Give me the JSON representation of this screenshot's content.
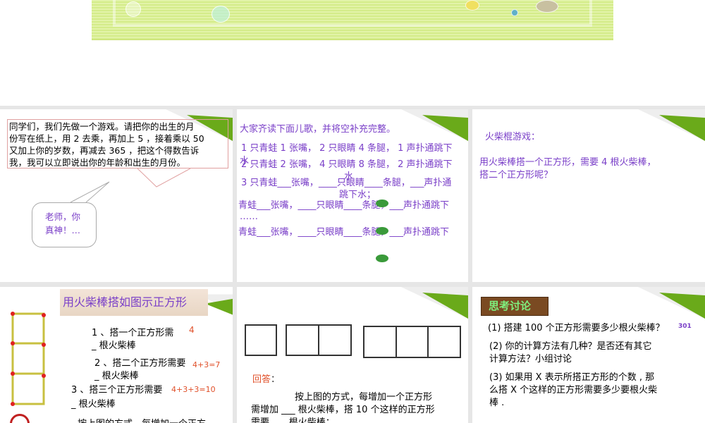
{
  "slides": [
    {
      "intro": [
        "同学们，我们先做一个游戏。请把你的出生的月",
        "份写在纸上，用 2 去乘，再加上 5 ，接着乘以 50",
        "又加上你的岁数，再减去 365 ，把这个得数告诉",
        "我，我可以立即说出你的年龄和出生的月份。"
      ],
      "reply": [
        "老师，你",
        "真神！…"
      ]
    },
    {
      "title": "大家齐读下面儿歌，并将空补充完整。",
      "lines": [
        "1 只青蛙 1 张嘴， 2 只眼睛 4 条腿， 1 声扑通跳下",
        "2 只青蛙 2 张嘴， 4 只眼睛 8 条腿， 2 声扑通跳下",
        "3 只青蛙___张嘴，____只眼睛____条腿，___声扑通",
        "跳下水；",
        "青蛙___张嘴，____只眼睛____条腿，___声扑通跳下",
        "……",
        "青蛙___张嘴，____只眼睛____条腿，___声扑通跳下"
      ],
      "overlap": [
        "水",
        "水"
      ]
    },
    {
      "title": "火柴棍游戏：",
      "lines": [
        "用火柴棒搭一个正方形，需要 4 根火柴棒，",
        "搭二个正方形呢？"
      ]
    },
    {
      "title": "用火柴棒搭如图示正方形",
      "q1": [
        "1 、搭一个正方形需 ",
        "_ 根火柴棒"
      ],
      "a1": "4",
      "q2": [
        "2 、搭二个正方形需要",
        "_ 根火柴棒"
      ],
      "a2": "4+3=7",
      "q3": [
        "3 、搭三个正方形需要",
        "_ 根火柴棒"
      ],
      "a3": "4+3+3=10",
      "cut": "按上图的方式，每增加一个正方"
    },
    {
      "answer_label": "回答",
      "colon": "：",
      "lines": [
        "按上图的方式，每增加一个正方形",
        "需增加 ___ 根火柴棒，搭 10 个这样的正方形",
        "需要 ___ 根火柴棒；"
      ]
    },
    {
      "title": "思考讨论",
      "q1": "(1) 搭建 100 个正方形需要多少根火柴棒？",
      "a1": "301",
      "q2": [
        "(2) 你的计算方法有几种？是否还有其它",
        "计算方法？小组讨论"
      ],
      "q3": [
        "(3) 如果用 X 表示所搭正方形的个数 , 那",
        "么搭 X 个这样的正方形需要多少要根火柴",
        "棒 ."
      ]
    }
  ],
  "colors": {
    "text_purple": "#7a3fc8",
    "answer_orange": "#e0502a",
    "curl_green": "#6aaa1a"
  }
}
